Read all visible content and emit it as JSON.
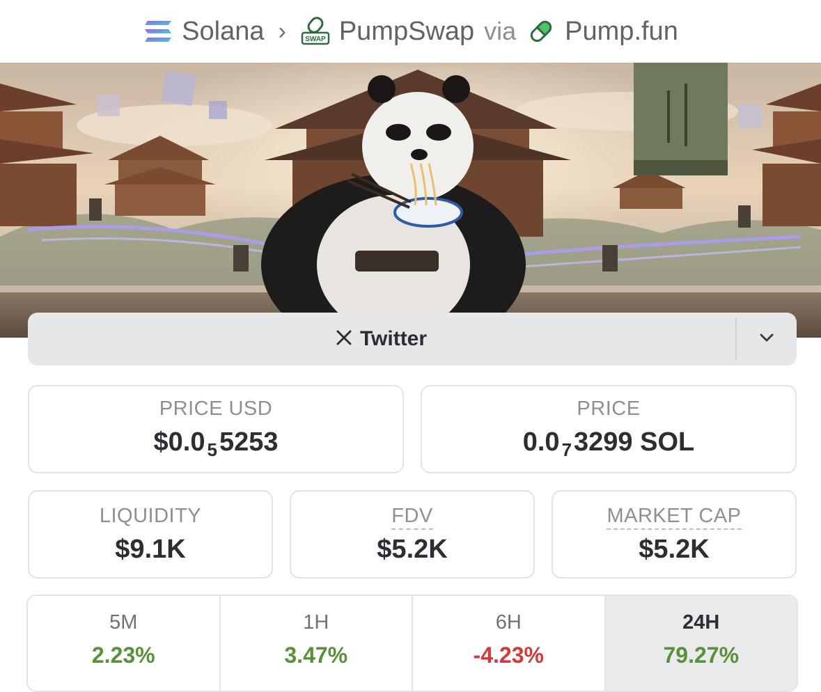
{
  "breadcrumb": {
    "chain": "Solana",
    "dex": "PumpSwap",
    "via": "via",
    "source": "Pump.fun",
    "dex_icon_text": "SWAP",
    "chain_icon": "solana-logo-icon",
    "dex_icon": "pumpswap-logo-icon",
    "source_icon": "pill-icon"
  },
  "banner": {
    "image": "panda-eating-noodles-banner"
  },
  "social": {
    "label": "Twitter",
    "icon": "x-logo-icon",
    "dropdown_icon": "chevron-down-icon"
  },
  "stats": {
    "price_usd": {
      "label": "PRICE USD",
      "prefix": "$0.0",
      "sub": "5",
      "suffix": "5253"
    },
    "price_native": {
      "label": "PRICE",
      "prefix": "0.0",
      "sub": "7",
      "suffix": "3299 SOL"
    },
    "liquidity": {
      "label": "LIQUIDITY",
      "value": "$9.1K"
    },
    "fdv": {
      "label": "FDV",
      "value": "$5.2K"
    },
    "market_cap": {
      "label": "MARKET CAP",
      "value": "$5.2K"
    }
  },
  "changes": [
    {
      "period": "5M",
      "value": "2.23%",
      "direction": "up"
    },
    {
      "period": "1H",
      "value": "3.47%",
      "direction": "up"
    },
    {
      "period": "6H",
      "value": "-4.23%",
      "direction": "down"
    },
    {
      "period": "24H",
      "value": "79.27%",
      "direction": "up",
      "selected": true
    }
  ],
  "colors": {
    "up": "#5a8f3c",
    "down": "#d13a3a"
  }
}
